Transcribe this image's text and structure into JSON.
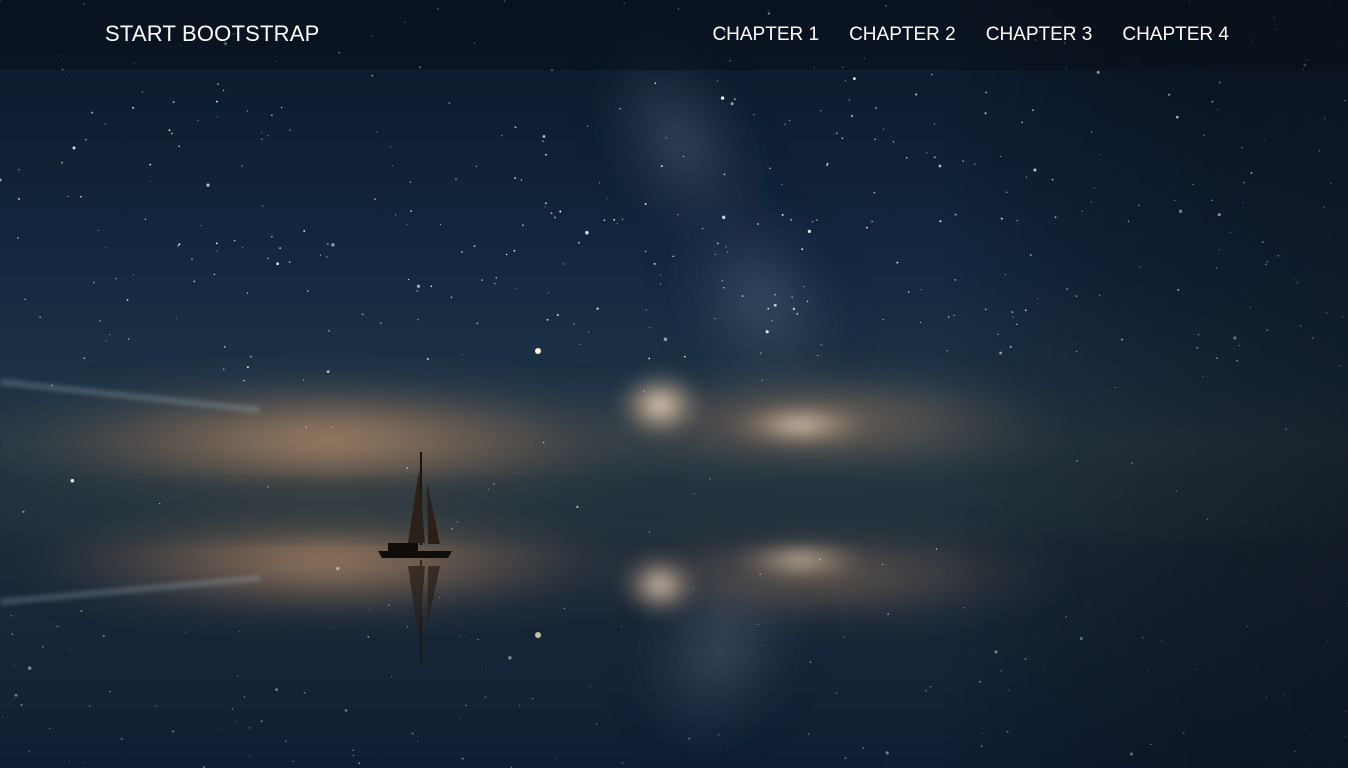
{
  "navbar": {
    "brand": "START BOOTSTRAP",
    "links": [
      "CHAPTER 1",
      "CHAPTER 2",
      "CHAPTER 3",
      "CHAPTER 4"
    ]
  },
  "hero": {
    "image": "starry night sky with milky way, glowing clouds and a sailboat reflected on still water"
  },
  "colors": {
    "nav_background": "#0a1018",
    "nav_text": "#ffffff",
    "sky_top": "#0c1a2e",
    "horizon_glow": "#c99a70"
  }
}
